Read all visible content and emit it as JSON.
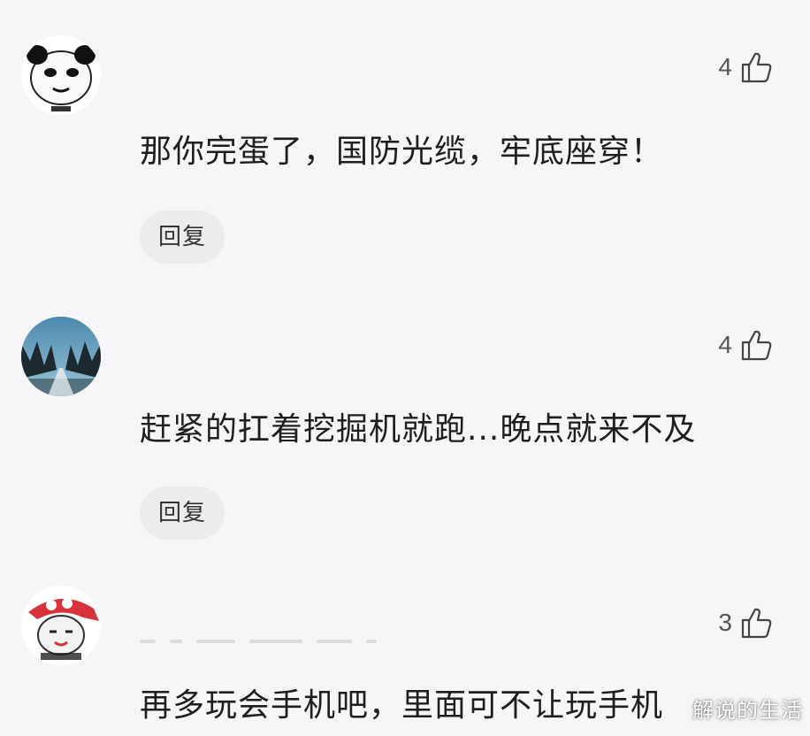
{
  "comments": [
    {
      "likes": "4",
      "text": "那你完蛋了，国防光缆，牢底座穿！",
      "reply_label": "回复",
      "avatar": "panda-meme-avatar"
    },
    {
      "likes": "4",
      "text": "赶紧的扛着挖掘机就跑...晚点就来不及",
      "reply_label": "回复",
      "avatar": "snowy-road-avatar"
    },
    {
      "likes": "3",
      "text": "再多玩会手机吧，里面可不让玩手机",
      "avatar": "red-bandana-meme-avatar"
    }
  ],
  "watermark": "解说的生活",
  "icons": {
    "like": "thumbs-up-icon"
  },
  "colors": {
    "background": "#f6f6f8",
    "text": "#1e1e1e",
    "reply_bg": "#ececee",
    "meta": "#555555"
  }
}
